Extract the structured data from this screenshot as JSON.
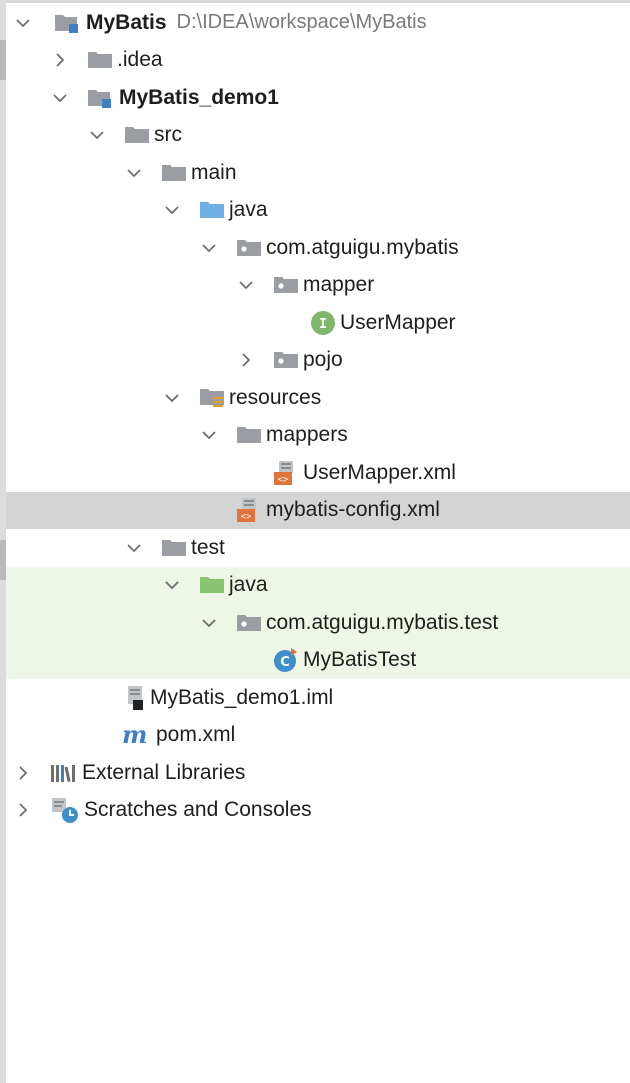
{
  "project_tree": {
    "root": {
      "label": "MyBatis",
      "path": "D:\\IDEA\\workspace\\MyBatis"
    },
    "idea": "idea",
    "module": "MyBatis_demo1",
    "src": "src",
    "main": "main",
    "main_java": "java",
    "package_main": "com.atguigu.mybatis",
    "mapper_pkg": "mapper",
    "user_mapper": "UserMapper",
    "pojo": "pojo",
    "resources": "resources",
    "mappers": "mappers",
    "user_mapper_xml": "UserMapper.xml",
    "mybatis_config": "mybatis-config.xml",
    "test": "test",
    "test_java": "java",
    "package_test": "com.atguigu.mybatis.test",
    "mybatis_test": "MyBatisTest",
    "iml": "MyBatis_demo1.iml",
    "pom": "pom.xml",
    "external_libraries": "External Libraries",
    "scratches": "Scratches and Consoles"
  },
  "colors": {
    "folder_gray": "#9a9ea3",
    "folder_blue": "#6fb1e6",
    "folder_green": "#89c470",
    "xml_orange": "#e0743a",
    "interface_green": "#7fb86b",
    "class_blue": "#3f8ec9",
    "selected_bg": "#d4d4d4",
    "test_bg": "#eef6e6"
  }
}
